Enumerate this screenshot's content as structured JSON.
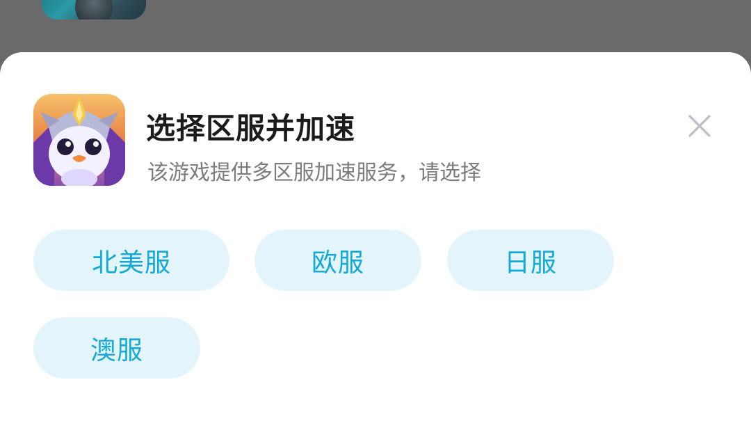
{
  "dialog": {
    "title": "选择区服并加速",
    "subtitle": "该游戏提供多区服加速服务，请选择",
    "close_icon": "close-icon"
  },
  "game": {
    "icon": "penguin-game-icon"
  },
  "regions": [
    {
      "label": "北美服"
    },
    {
      "label": "欧服"
    },
    {
      "label": "日服"
    },
    {
      "label": "澳服"
    }
  ],
  "colors": {
    "button_bg": "#e3f5fa",
    "button_text": "#16a9d8",
    "overlay": "#6a6a6a"
  }
}
